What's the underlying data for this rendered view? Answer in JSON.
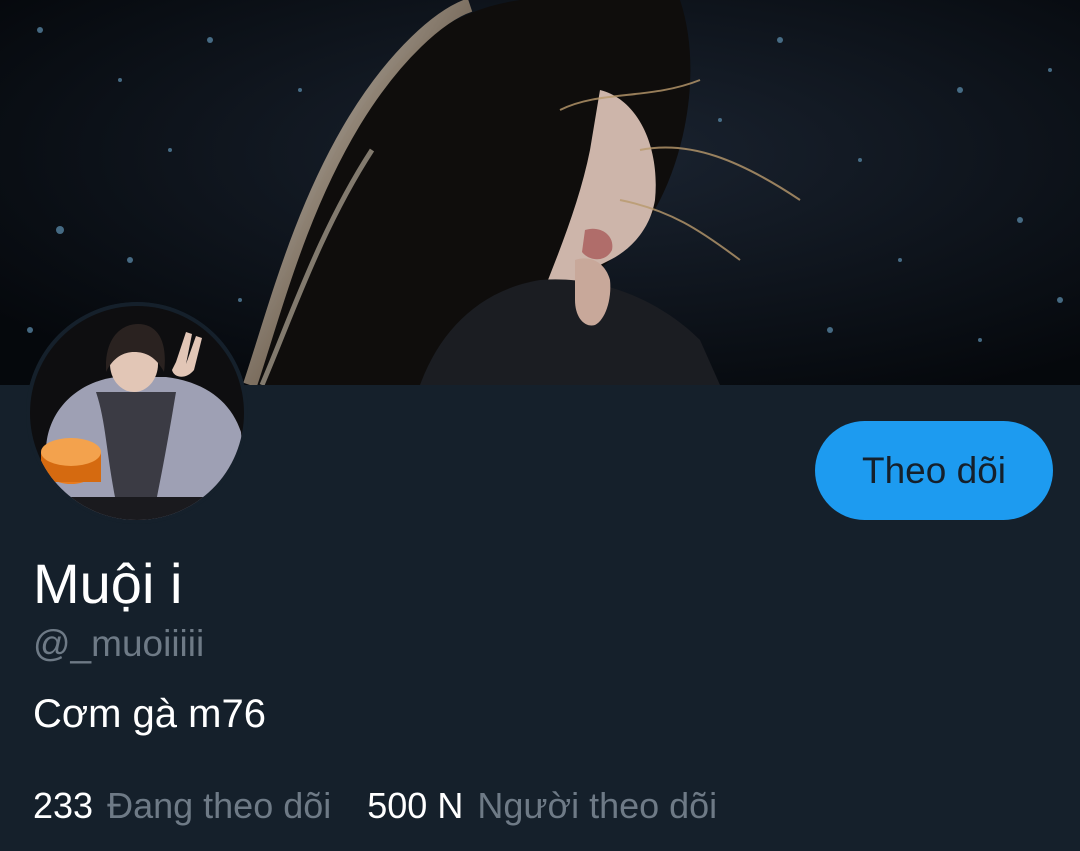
{
  "profile": {
    "display_name": "Muội i",
    "handle": "@_muoiiiii",
    "bio": "Cơm gà m76",
    "follow_button_label": "Theo dõi",
    "stats": {
      "following_count": "233",
      "following_label": "Đang theo dõi",
      "followers_count": "500 N",
      "followers_label": "Người theo dõi"
    }
  },
  "colors": {
    "background": "#15202b",
    "accent": "#1d9bf0",
    "muted_text": "#6e7a86",
    "primary_text": "#ffffff"
  }
}
